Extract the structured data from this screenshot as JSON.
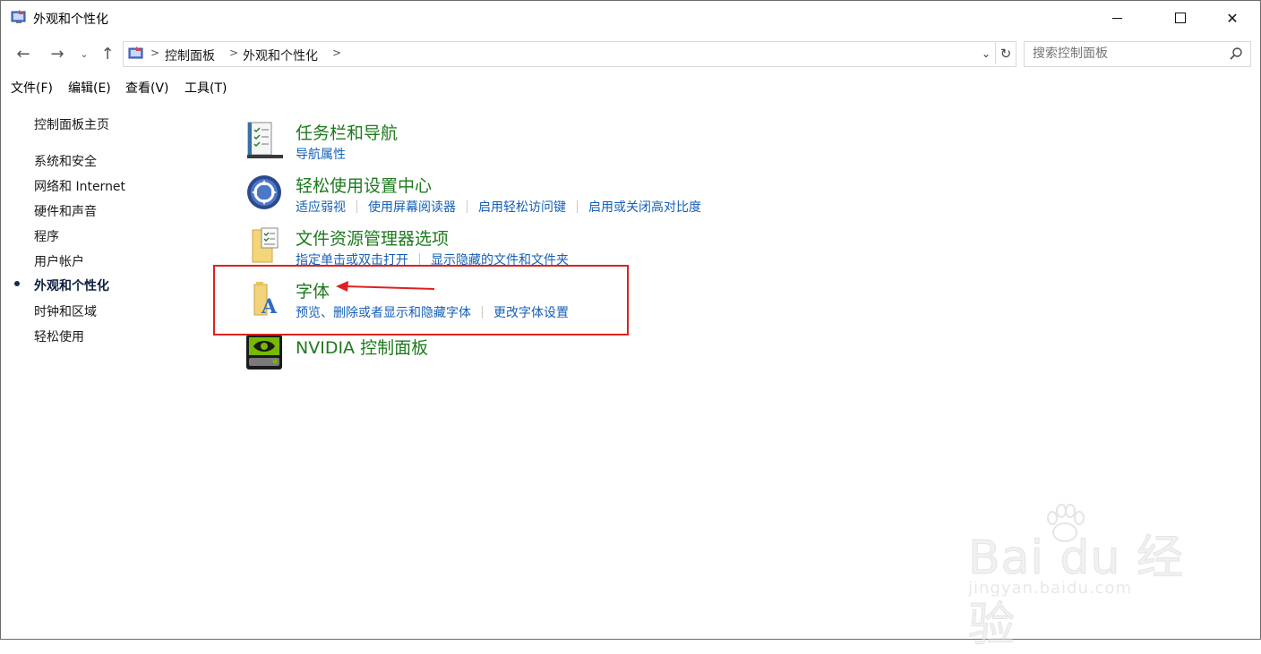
{
  "window": {
    "title": "外观和个性化",
    "minimize": "—",
    "maximize": "□",
    "close": "✕"
  },
  "nav": {
    "back": "←",
    "forward": "→",
    "recent": "⌄",
    "up": "↑",
    "breadcrumb": [
      "控制面板",
      "外观和个性化"
    ],
    "dropdown": "⌄",
    "refresh": "↻",
    "search_placeholder": "搜索控制面板"
  },
  "menu": [
    "文件(F)",
    "编辑(E)",
    "查看(V)",
    "工具(T)"
  ],
  "sidebar": {
    "home": "控制面板主页",
    "items": [
      "系统和安全",
      "网络和 Internet",
      "硬件和声音",
      "程序",
      "用户帐户",
      "外观和个性化",
      "时钟和区域",
      "轻松使用"
    ],
    "active_index": 5
  },
  "categories": [
    {
      "icon": "taskbar-checklist-icon",
      "title": "任务栏和导航",
      "links": [
        "导航属性"
      ]
    },
    {
      "icon": "ease-of-access-icon",
      "title": "轻松使用设置中心",
      "links": [
        "适应弱视",
        "使用屏幕阅读器",
        "启用轻松访问键",
        "启用或关闭高对比度"
      ]
    },
    {
      "icon": "file-explorer-options-icon",
      "title": "文件资源管理器选项",
      "links": [
        "指定单击或双击打开",
        "显示隐藏的文件和文件夹"
      ]
    },
    {
      "icon": "fonts-folder-icon",
      "title": "字体",
      "links": [
        "预览、删除或者显示和隐藏字体",
        "更改字体设置"
      ]
    },
    {
      "icon": "nvidia-icon",
      "title": "NVIDIA 控制面板",
      "links": []
    }
  ],
  "colors": {
    "category_title": "#1e7a1e",
    "link": "#1560b7",
    "annotation": "#e02020"
  },
  "watermark": {
    "logo": "Bai du 经验",
    "sub": "jingyan.baidu.com"
  }
}
